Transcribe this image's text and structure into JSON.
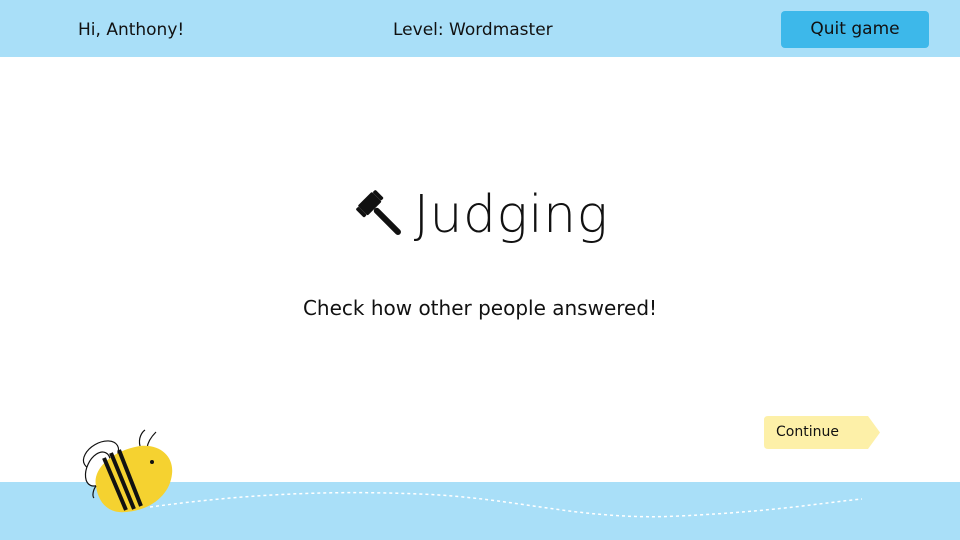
{
  "header": {
    "greeting": "Hi, Anthony!",
    "level_text": "Level: Wordmaster",
    "quit_label": "Quit game"
  },
  "main": {
    "title": "Judging",
    "title_icon": "gavel-icon",
    "subtitle": "Check how other people answered!"
  },
  "actions": {
    "continue_label": "Continue"
  },
  "decor": {
    "mascot_icon": "bee-icon"
  },
  "colors": {
    "band": "#a9dff8",
    "quit_button": "#3db8ea",
    "continue_button": "#fdf0a8",
    "bee_body": "#f5d230"
  }
}
